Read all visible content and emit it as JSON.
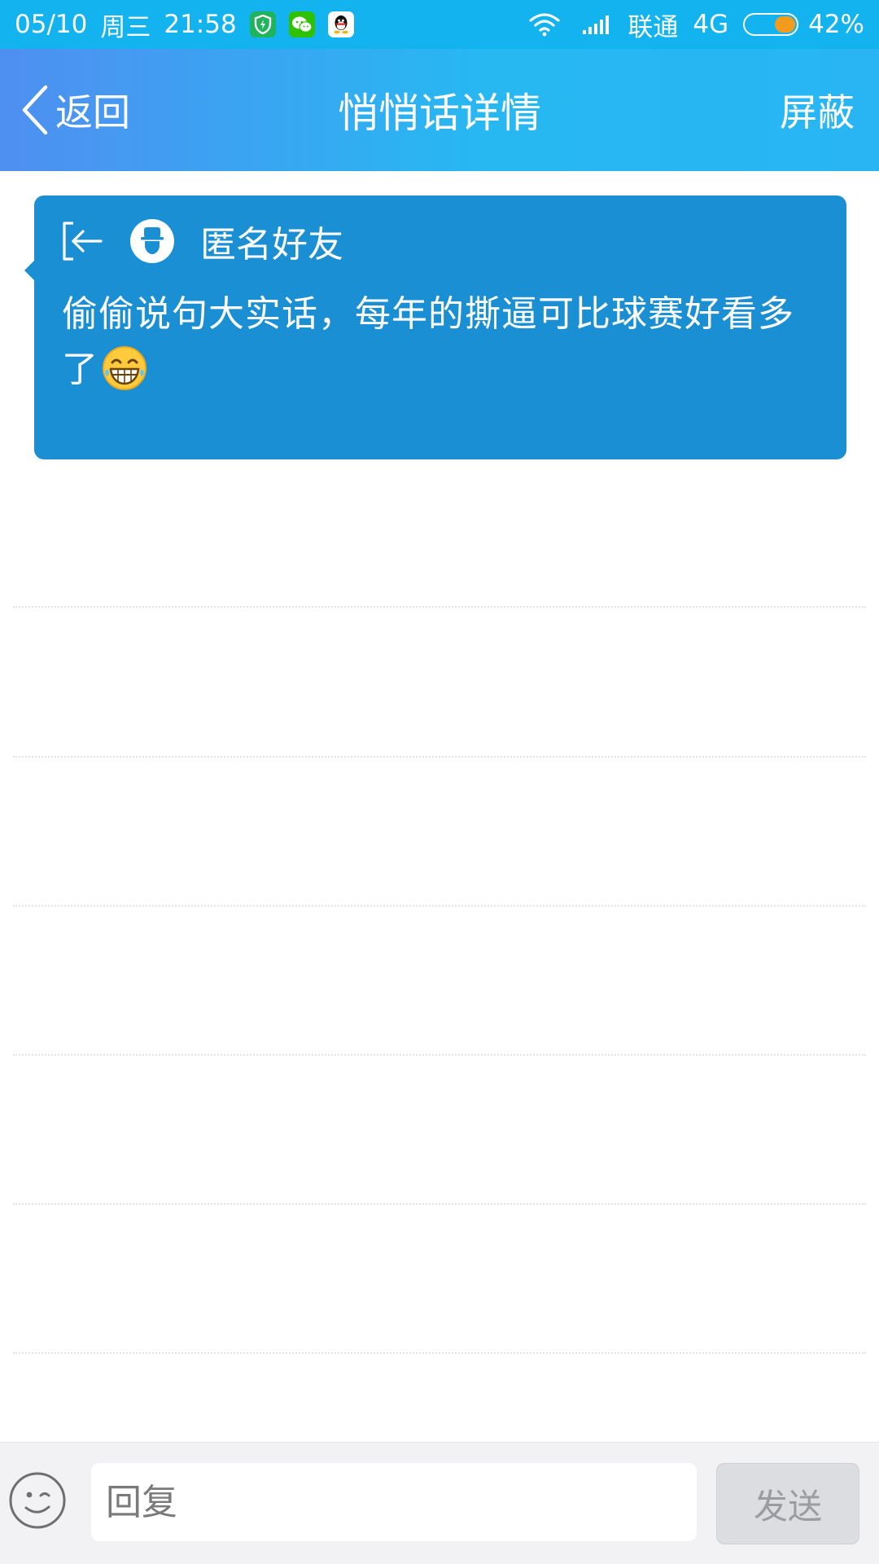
{
  "status_bar": {
    "date": "05/10",
    "weekday": "周三",
    "time": "21:58",
    "notification_icons": [
      "shield-icon",
      "wechat-icon",
      "qq-icon"
    ],
    "carrier": "联通",
    "network": "4G",
    "battery_percent": "42%",
    "battery_level": 0.42,
    "background_color": "#12b3ee"
  },
  "nav": {
    "back_label": "返回",
    "title": "悄悄话详情",
    "action_label": "屏蔽",
    "gradient_colors": [
      "#4f8ff1",
      "#27b8f2"
    ]
  },
  "message": {
    "sender": "匿名好友",
    "text": "偷偷说句大实话，每年的撕逼可比球赛好看多了",
    "emoji": "grinning-sweat-emoji",
    "card_color": "#1b8fd3",
    "icons": [
      "reply-arrow-icon",
      "anonymous-avatar-icon"
    ]
  },
  "reply_bar": {
    "placeholder": "回复",
    "send_label": "发送",
    "emoji_icon": "smiley-icon"
  }
}
